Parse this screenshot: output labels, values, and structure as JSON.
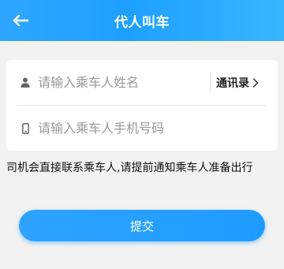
{
  "header": {
    "title": "代人叫车",
    "back_icon": "arrow-left-icon"
  },
  "form": {
    "name": {
      "placeholder": "请输入乘车人姓名",
      "icon": "person-icon"
    },
    "contacts_label": "通讯录",
    "contacts_icon": "chevron-right-icon",
    "phone": {
      "placeholder": "请输入乘车人手机号码",
      "icon": "phone-icon"
    }
  },
  "notice": "司机会直接联系乘车人,请提前通知乘车人准备出行",
  "submit_label": "提交",
  "colors": {
    "primary": "#1e9bff",
    "background": "#f2f2f2"
  }
}
